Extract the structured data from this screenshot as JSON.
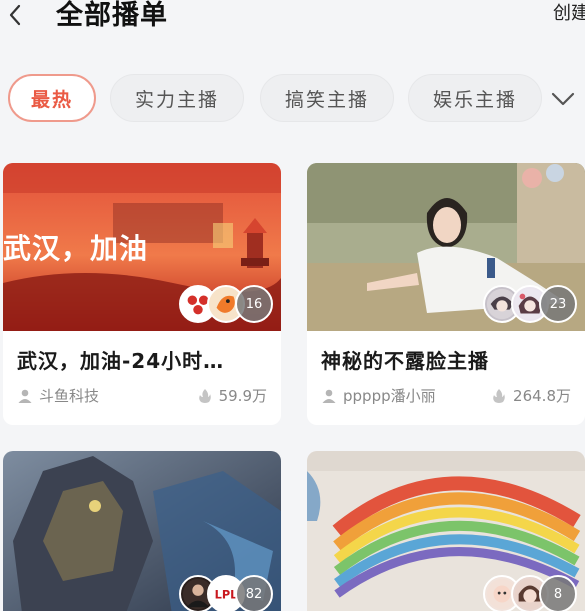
{
  "header": {
    "title": "全部播单",
    "create_label": "创建"
  },
  "tabs": [
    {
      "label": "最热",
      "active": true
    },
    {
      "label": "实力主播",
      "active": false
    },
    {
      "label": "搞笑主播",
      "active": false
    },
    {
      "label": "娱乐主播",
      "active": false
    }
  ],
  "more_icon": "chevron-down-icon",
  "cards": [
    {
      "banner_text": "武汉，加油",
      "title": "武汉，加油-24小时…",
      "author": "斗鱼科技",
      "views": "59.9万",
      "count": "16"
    },
    {
      "title": "神秘的不露脸主播",
      "author": "ppppp潘小丽",
      "views": "264.8万",
      "count": "23"
    },
    {
      "count": "82",
      "badge_text": "LPL"
    },
    {
      "count": "8"
    }
  ],
  "colors": {
    "accent": "#ea5a44",
    "chip_border": "#ef9a8c"
  }
}
